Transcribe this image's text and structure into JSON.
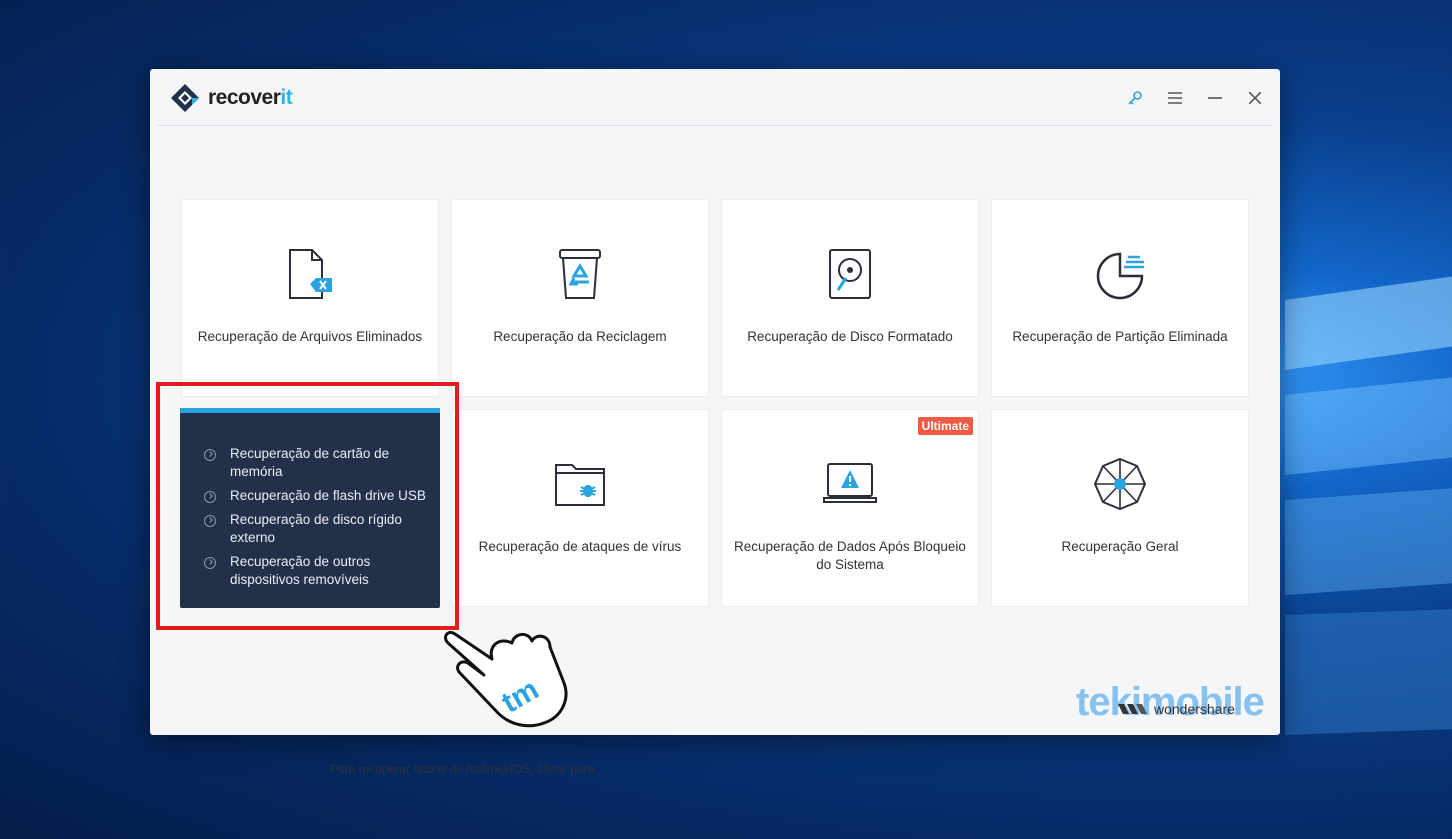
{
  "app": {
    "name_part1": "recover",
    "name_part2": "it"
  },
  "window_controls": {
    "key_icon": "key-icon",
    "menu_icon": "menu-icon",
    "minimize_icon": "minimize-icon",
    "close_icon": "close-icon"
  },
  "cards": [
    {
      "label": "Recuperação de Arquivos Eliminados",
      "icon": "file-delete-icon"
    },
    {
      "label": "Recuperação da Reciclagem",
      "icon": "recycle-bin-icon"
    },
    {
      "label": "Recuperação de Disco Formatado",
      "icon": "hard-disk-icon"
    },
    {
      "label": "Recuperação de Partição Eliminada",
      "icon": "partition-icon"
    },
    {
      "label": "Recuperação de ataques de vírus",
      "icon": "virus-folder-icon"
    },
    {
      "label": "Recuperação de Dados Após Bloqueio do Sistema",
      "icon": "laptop-warning-icon",
      "badge": "Ultimate"
    },
    {
      "label": "Recuperação Geral",
      "icon": "web-icon"
    }
  ],
  "external_devices": [
    "Recuperação de cartão de memória",
    "Recuperação de flash drive USB",
    "Recuperação de disco rígido externo",
    "Recuperação de outros dispositivos removíveis"
  ],
  "footer": {
    "android_ios_text": "Para recuperar dados do Android/iOS, altere para",
    "brand": "wondershare"
  },
  "watermark": {
    "text": "tekimobile",
    "hand_text": "tm"
  },
  "colors": {
    "accent": "#2aa4e0",
    "dark_card": "#23304a",
    "badge": "#ef5a42",
    "highlight": "#e21b1b"
  }
}
